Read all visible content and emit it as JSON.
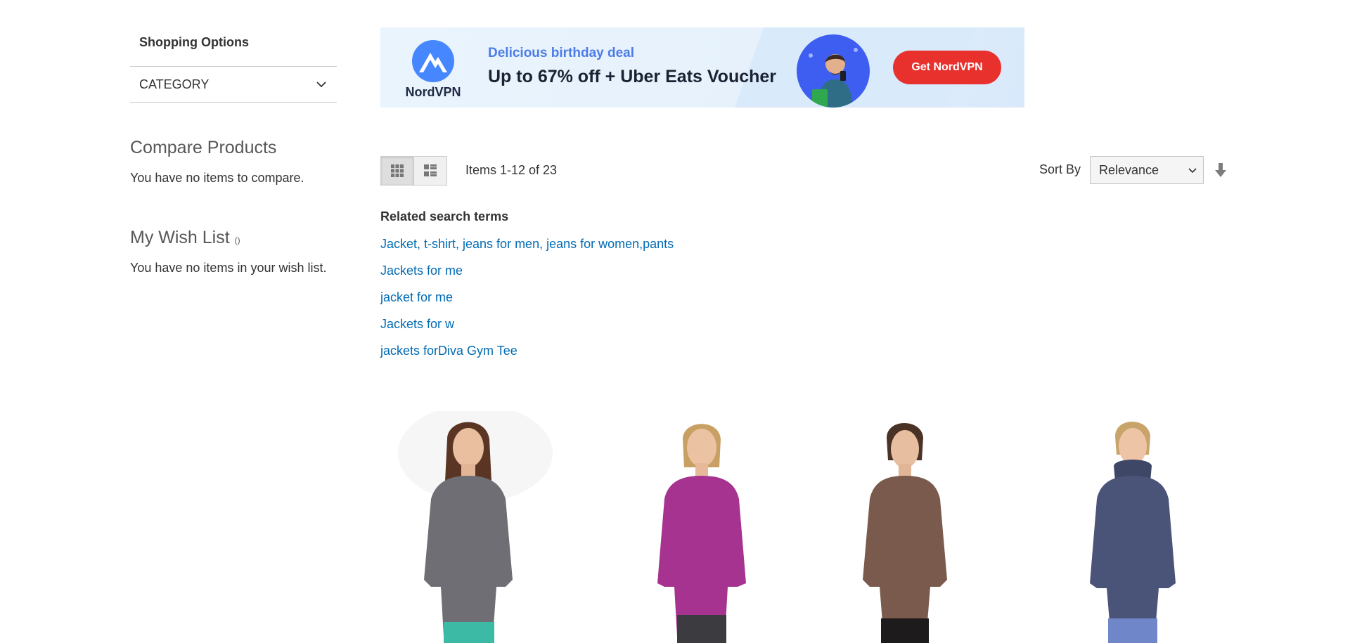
{
  "sidebar": {
    "shopping_options": "Shopping Options",
    "category_label": "CATEGORY",
    "compare": {
      "title": "Compare Products",
      "empty_text": "You have no items to compare."
    },
    "wishlist": {
      "title": "My Wish List",
      "count": "()",
      "empty_text": "You have no items in your wish list."
    }
  },
  "banner": {
    "brand": "NordVPN",
    "subtitle": "Delicious birthday deal",
    "headline": "Up to 67% off + Uber Eats Voucher",
    "cta_label": "Get NordVPN",
    "colors": {
      "cta": "#e8312d",
      "subtitle": "#4c7ce8",
      "logo": "#4687ff"
    }
  },
  "toolbar": {
    "view_modes": [
      "grid",
      "list"
    ],
    "active_mode": "grid",
    "amount_text": "Items 1-12 of 23",
    "sort_label": "Sort By",
    "sort_value": "Relevance",
    "sort_direction_icon": "arrow-down-icon"
  },
  "related_search": {
    "title": "Related search terms",
    "terms": [
      "Jacket, t-shirt, jeans for men, jeans for women,pants",
      "Jackets for me",
      "jacket for me",
      "Jackets for w",
      "jackets forDiva Gym Tee"
    ]
  },
  "products": [
    {
      "image": "woman-gray-quarter-zip-jacket",
      "color": "#6e6e74"
    },
    {
      "image": "woman-magenta-zip-jacket",
      "color": "#a5338f"
    },
    {
      "image": "woman-brown-zip-jacket",
      "color": "#7a5a4c"
    },
    {
      "image": "woman-navy-cowl-neck-top",
      "color": "#4a5478"
    }
  ],
  "colors": {
    "link": "#006bb4",
    "text": "#333333",
    "border": "#cccccc"
  }
}
